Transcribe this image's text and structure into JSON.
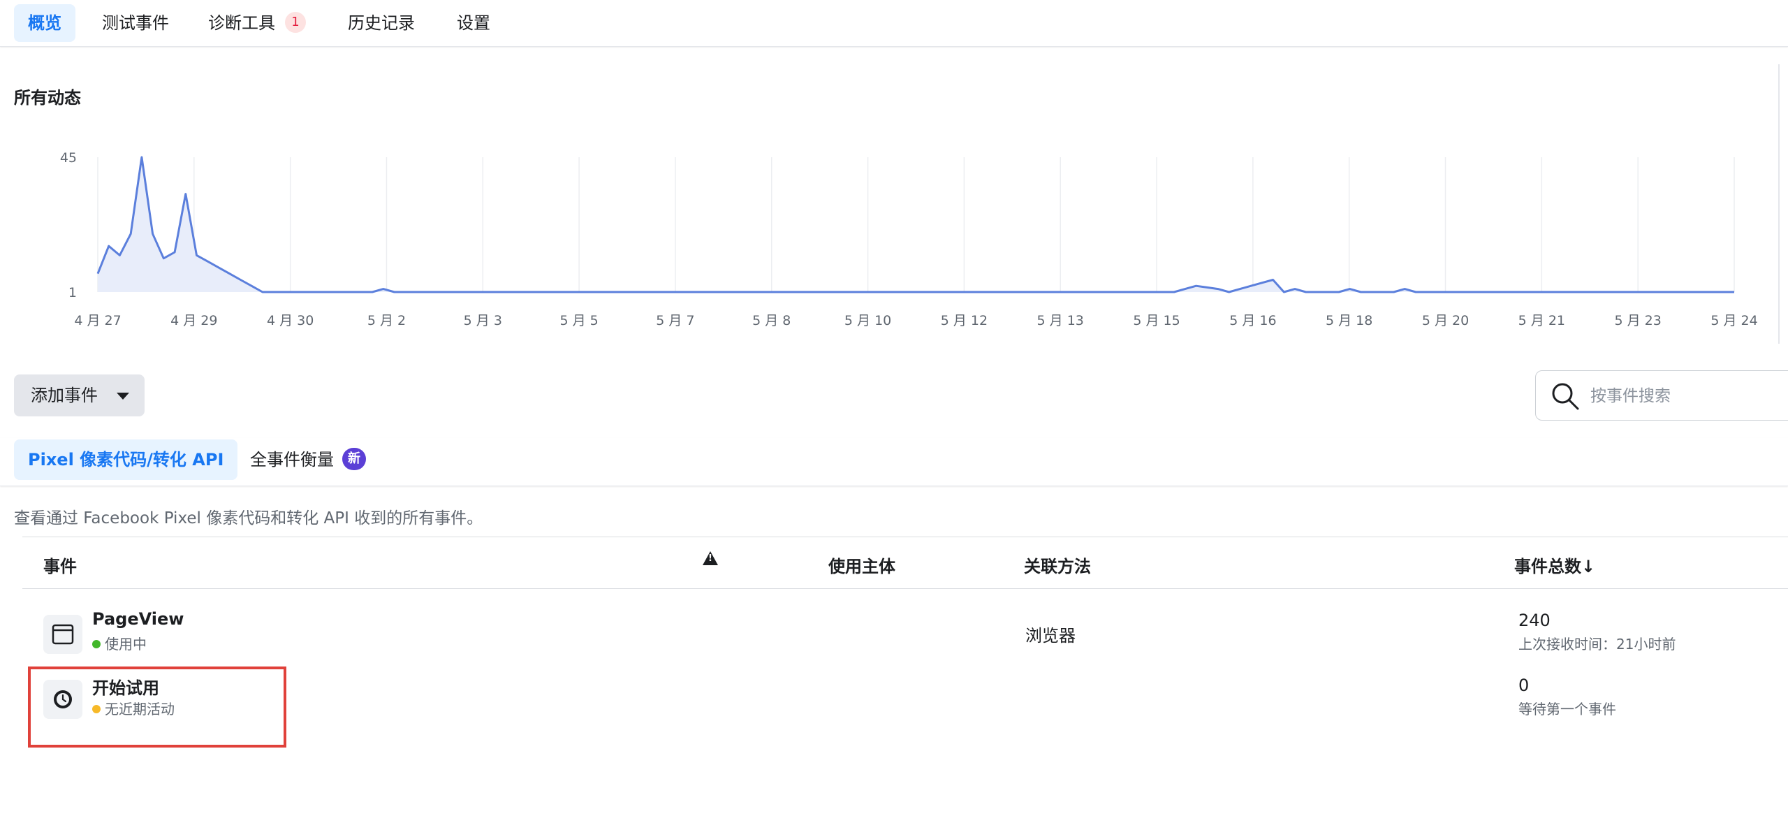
{
  "nav": {
    "tabs": [
      {
        "label": "概览",
        "active": true
      },
      {
        "label": "测试事件"
      },
      {
        "label": "诊断工具",
        "badge": "1"
      },
      {
        "label": "历史记录"
      },
      {
        "label": "设置"
      }
    ]
  },
  "section_title": "所有动态",
  "chart_data": {
    "type": "area",
    "title": "",
    "xlabel": "",
    "ylabel": "",
    "y_ticks": [
      "45",
      "1"
    ],
    "x_ticks": [
      "4 月 27",
      "4 月 29",
      "4 月 30",
      "5 月 2",
      "5 月 3",
      "5 月 5",
      "5 月 7",
      "5 月 8",
      "5 月 10",
      "5 月 12",
      "5 月 13",
      "5 月 15",
      "5 月 16",
      "5 月 18",
      "5 月 20",
      "5 月 21",
      "5 月 23",
      "5 月 24"
    ],
    "ylim": [
      1,
      45
    ],
    "grid": true,
    "line_color": "#5b7fdc",
    "fill_color": "#e8edfa",
    "series": [
      {
        "values": [
          7,
          16,
          13,
          20,
          45,
          20,
          12,
          14,
          33,
          13,
          11,
          9,
          7,
          5,
          3,
          1,
          1,
          1,
          1,
          1,
          1,
          1,
          1,
          1,
          1,
          1,
          2,
          1,
          1,
          1,
          1,
          1,
          1,
          1,
          1,
          1,
          1,
          1,
          1,
          1,
          1,
          1,
          1,
          1,
          1,
          1,
          1,
          1,
          1,
          1,
          1,
          1,
          1,
          1,
          1,
          1,
          1,
          1,
          1,
          1,
          1,
          1,
          1,
          1,
          1,
          1,
          1,
          1,
          1,
          1,
          1,
          1,
          1,
          1,
          1,
          1,
          1,
          1,
          1,
          1,
          1,
          1,
          1,
          1,
          1,
          1,
          1,
          1,
          1,
          1,
          1,
          1,
          1,
          1,
          1,
          1,
          1,
          1,
          1,
          2,
          3,
          2.5,
          2,
          1,
          2,
          3,
          4,
          5,
          1,
          2,
          1,
          1,
          1,
          1,
          2,
          1,
          1,
          1,
          1,
          2,
          1,
          1,
          1,
          1,
          1,
          1,
          1,
          1,
          1,
          1,
          1,
          1,
          1,
          1,
          1,
          1,
          1,
          1,
          1,
          1,
          1,
          1,
          1,
          1,
          1,
          1,
          1,
          1,
          1,
          1
        ]
      }
    ]
  },
  "toolbar": {
    "add_event": "添加事件",
    "search_placeholder": "按事件搜索"
  },
  "subnav": {
    "tabs": [
      {
        "label": "Pixel 像素代码/转化 API",
        "active": true
      },
      {
        "label": "全事件衡量",
        "badge": "新"
      }
    ]
  },
  "description": "查看通过 Facebook Pixel 像素代码和转化 API 收到的所有事件。",
  "table": {
    "columns": {
      "event": "事件",
      "entity": "使用主体",
      "method": "关联方法",
      "count": "事件总数↓"
    },
    "rows": [
      {
        "name": "PageView",
        "status": "使用中",
        "status_color": "#42b72a",
        "icon": "browser-window-icon",
        "method": "浏览器",
        "count": "240",
        "sub": "上次接收时间：21小时前"
      },
      {
        "name": "开始试用",
        "status": "无近期活动",
        "status_color": "#f7b928",
        "icon": "clock-icon",
        "method": "",
        "count": "0",
        "sub": "等待第一个事件"
      }
    ]
  }
}
